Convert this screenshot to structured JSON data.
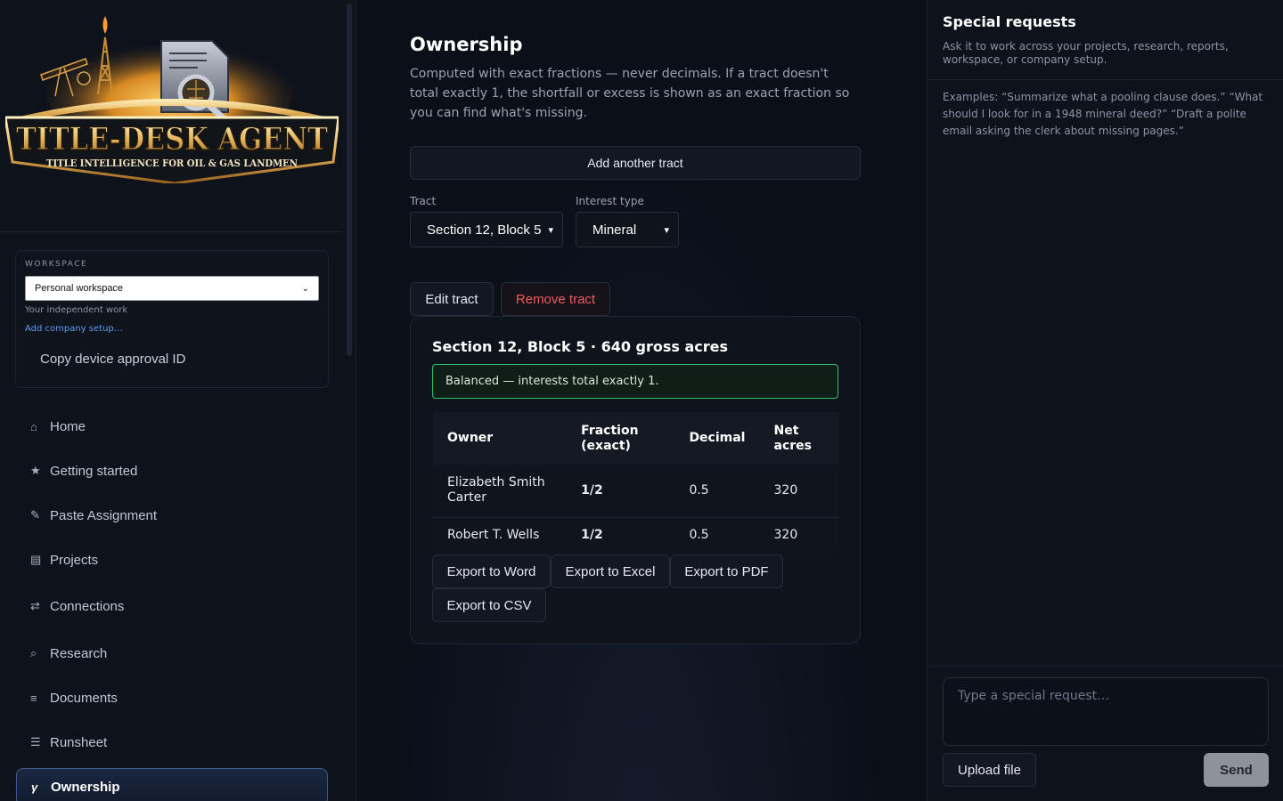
{
  "brand": {
    "logo_title": "TITLE-DESK AGENT",
    "logo_tagline": "TITLE INTELLIGENCE FOR OIL & GAS LANDMEN"
  },
  "sidebar": {
    "workspace": {
      "label": "WORKSPACE",
      "selected": "Personal workspace",
      "subtitle": "Your independent work",
      "link": "Add company setup…",
      "copy_button": "Copy device approval ID"
    },
    "nav": [
      {
        "label": "Home",
        "icon": "home-icon",
        "glyph": "⌂"
      },
      {
        "label": "Getting started",
        "icon": "star-icon",
        "glyph": "★"
      },
      {
        "label": "Paste Assignment",
        "icon": "pencil-icon",
        "glyph": "✎"
      },
      {
        "label": "Projects",
        "icon": "projects-icon",
        "glyph": "▤"
      },
      {
        "label": "Connections",
        "icon": "swap-icon",
        "glyph": "⇄"
      },
      {
        "label": "Research",
        "icon": "search-icon",
        "glyph": "⌕"
      },
      {
        "label": "Documents",
        "icon": "documents-icon",
        "glyph": "≡"
      },
      {
        "label": "Runsheet",
        "icon": "list-icon",
        "glyph": "☰"
      },
      {
        "label": "Ownership",
        "icon": "gamma-icon",
        "glyph": "γ",
        "active": true
      }
    ]
  },
  "main": {
    "title": "Ownership",
    "description": "Computed with exact fractions — never decimals. If a tract doesn't total exactly 1, the shortfall or excess is shown as an exact fraction so you can find what's missing.",
    "add_tract_button": "Add another tract",
    "tract_field": {
      "label": "Tract",
      "value": "Section 12, Block 5"
    },
    "interest_field": {
      "label": "Interest type",
      "value": "Mineral"
    },
    "edit_button": "Edit tract",
    "remove_button": "Remove tract",
    "card": {
      "title": "Section 12, Block 5 · 640 gross acres",
      "status": "Balanced — interests total exactly 1.",
      "columns": [
        "Owner",
        "Fraction (exact)",
        "Decimal",
        "Net acres"
      ],
      "rows": [
        {
          "owner": "Elizabeth Smith Carter",
          "fraction": "1/2",
          "decimal": "0.5",
          "net_acres": "320"
        },
        {
          "owner": "Robert T. Wells",
          "fraction": "1/2",
          "decimal": "0.5",
          "net_acres": "320"
        }
      ],
      "exports": [
        "Export to Word",
        "Export to Excel",
        "Export to PDF",
        "Export to CSV"
      ]
    }
  },
  "right_panel": {
    "title": "Special requests",
    "subtitle": "Ask it to work across your projects, research, reports, workspace, or company setup.",
    "examples": "Examples: “Summarize what a pooling clause does.” “What should I look for in a 1948 mineral deed?” “Draft a polite email asking the clerk about missing pages.”",
    "input_placeholder": "Type a special request…",
    "upload_button": "Upload file",
    "send_button": "Send"
  },
  "colors": {
    "background": "#0b0f18",
    "accent_blue": "#5b9cf5",
    "balanced_green": "#2ec26c",
    "danger_red": "#ef5a5a",
    "active_nav_border": "#3b5b91"
  }
}
